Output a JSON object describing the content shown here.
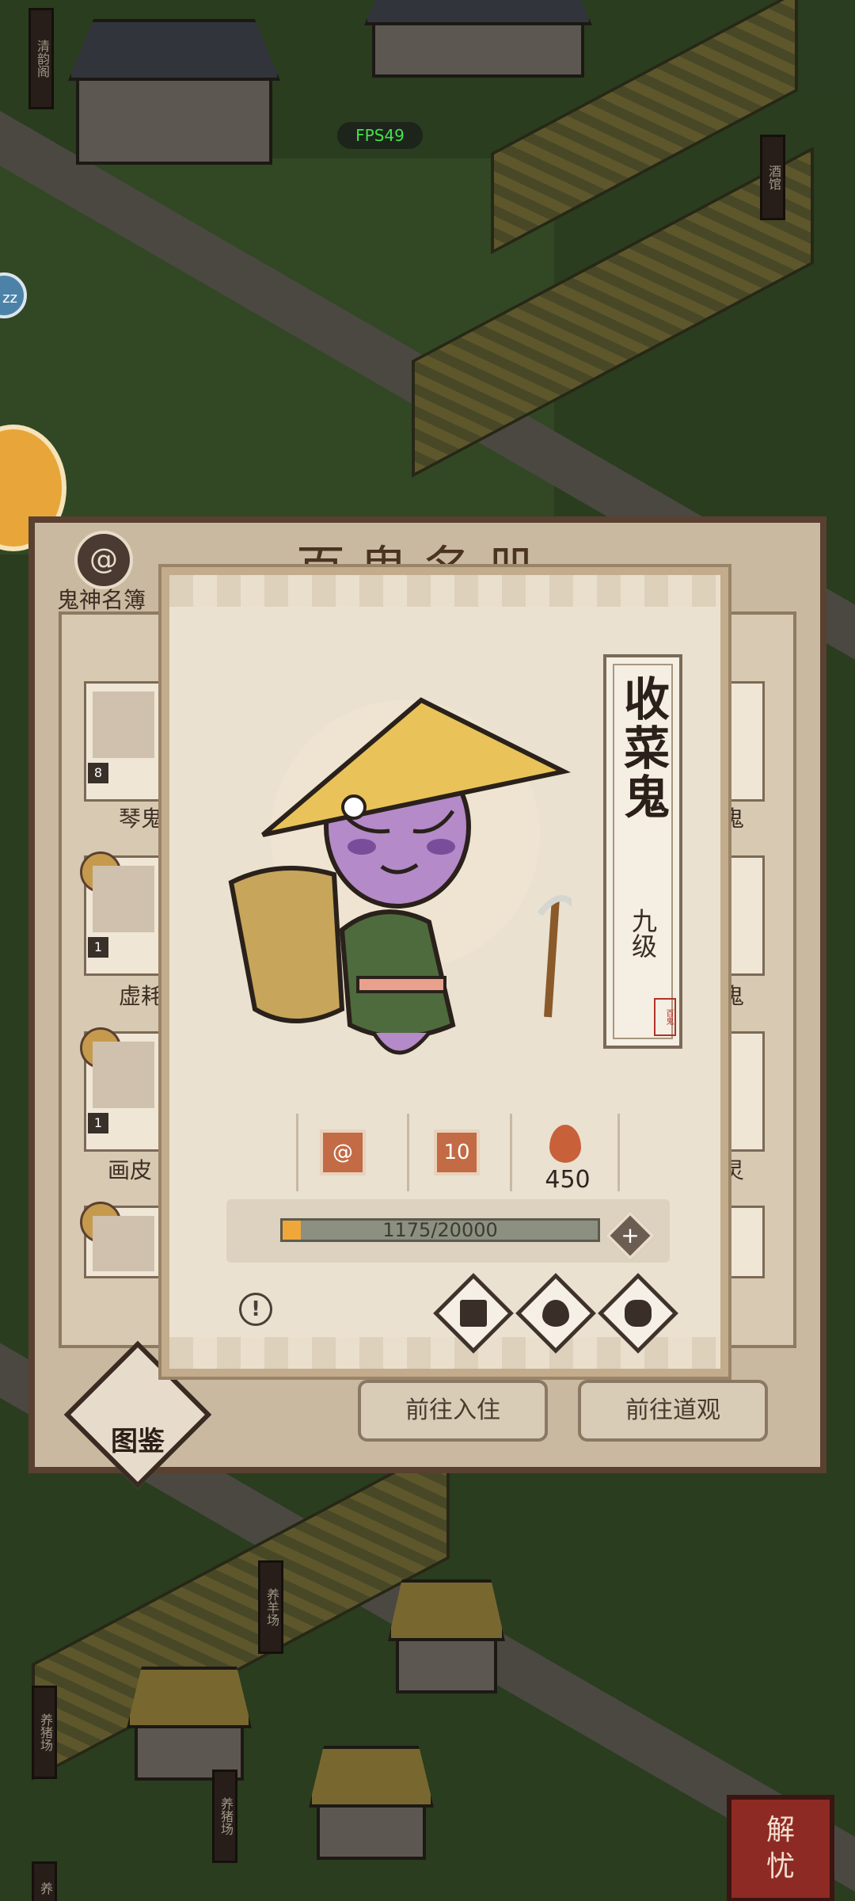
{
  "hud": {
    "fps": "FPS49",
    "zz": "zz",
    "jieyou_button": [
      "解",
      "忧"
    ]
  },
  "world_signs": [
    "清韵阁",
    "酒馆",
    "养羊场",
    "养猪场",
    "养猪场",
    "养"
  ],
  "book": {
    "title": "百鬼名册",
    "tab_label": "鬼神名簿",
    "tab_icon": "swirl-icon",
    "entries": [
      {
        "name": "琴鬼",
        "level": "8"
      },
      {
        "name": "虚耗",
        "level": "1"
      },
      {
        "name": "画皮",
        "level": "1"
      },
      {
        "name": "鬼"
      },
      {
        "name": "鬼"
      },
      {
        "name": "灵"
      }
    ],
    "buttons": {
      "goto_residence": "前往入住",
      "goto_temple": "前往道观",
      "tujian": "图鉴"
    }
  },
  "detail": {
    "name": "收菜鬼",
    "level": "九级",
    "seal": "百鬼",
    "stats": {
      "skill_icon": "swirl-icon",
      "level_value": "10",
      "fire_value": "450"
    },
    "progress": {
      "text": "1175/20000",
      "current": 1175,
      "max": 20000
    },
    "add_button": "+",
    "info_button": "!",
    "actions": [
      "book-icon",
      "fire-icon",
      "bag-icon"
    ]
  },
  "colors": {
    "accent": "#c26b45",
    "progress_fill": "#f0a73a",
    "fps_text": "#44e34b"
  }
}
